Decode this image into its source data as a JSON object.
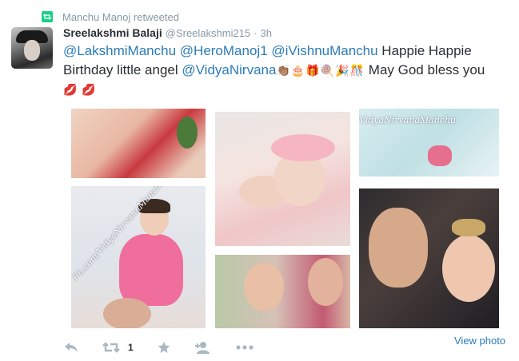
{
  "retweet_context": {
    "text": "Manchu Manoj retweeted"
  },
  "tweet": {
    "fullname": "Sreelakshmi Balaji",
    "username": "@Sreelakshmi215",
    "separator": "·",
    "time": "3h",
    "text": {
      "mention1": "@LakshmiManchu",
      "mention2": "@HeroManoj1",
      "mention3": "@iVishnuManchu",
      "text1": " Happie Happie Birthday little angel ",
      "mention4": "@VidyaNirvana",
      "emojis": [
        "👏🏽",
        "🎂",
        "🎁",
        "🍭",
        "🎉",
        "🎊"
      ],
      "text2": " May God bless you",
      "lips_emojis": [
        "💋",
        "💋"
      ]
    }
  },
  "photos": {
    "watermark_top_right": "VidyaNirvanaManchu",
    "watermark_left": "Fb.com/VidyaNirvanaManchu"
  },
  "actions": {
    "icons": [
      "reply-icon",
      "retweet-icon",
      "favorite-icon",
      "follow-icon",
      "more-icon"
    ],
    "retweet_count": "1",
    "view_photo": "View photo"
  },
  "colors": {
    "link": "#2b7bb9",
    "muted": "#8899a6",
    "retweet_badge": "#19cf86",
    "action_icon": "#aab8c2"
  }
}
